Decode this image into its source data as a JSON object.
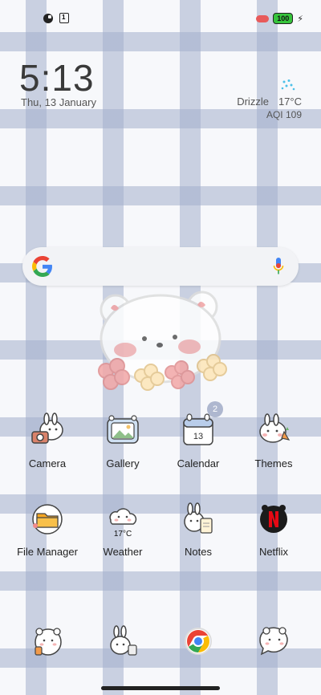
{
  "status_bar": {
    "battery": "100"
  },
  "clock": {
    "time": "5:13",
    "date": "Thu, 13 January"
  },
  "weather_widget": {
    "condition": "Drizzle",
    "temperature": "17°C",
    "aqi": "AQI 109"
  },
  "apps_row1": [
    {
      "label": "Camera"
    },
    {
      "label": "Gallery"
    },
    {
      "label": "Calendar",
      "icon_text": "13",
      "badge": "2"
    },
    {
      "label": "Themes"
    }
  ],
  "apps_row2": [
    {
      "label": "File Manager"
    },
    {
      "label": "Weather",
      "icon_text": "17°C"
    },
    {
      "label": "Notes"
    },
    {
      "label": "Netflix"
    }
  ],
  "colors": {
    "gingham": "#a3b0cc",
    "netflix_red": "#e50914",
    "battery_green": "#36c43c"
  }
}
